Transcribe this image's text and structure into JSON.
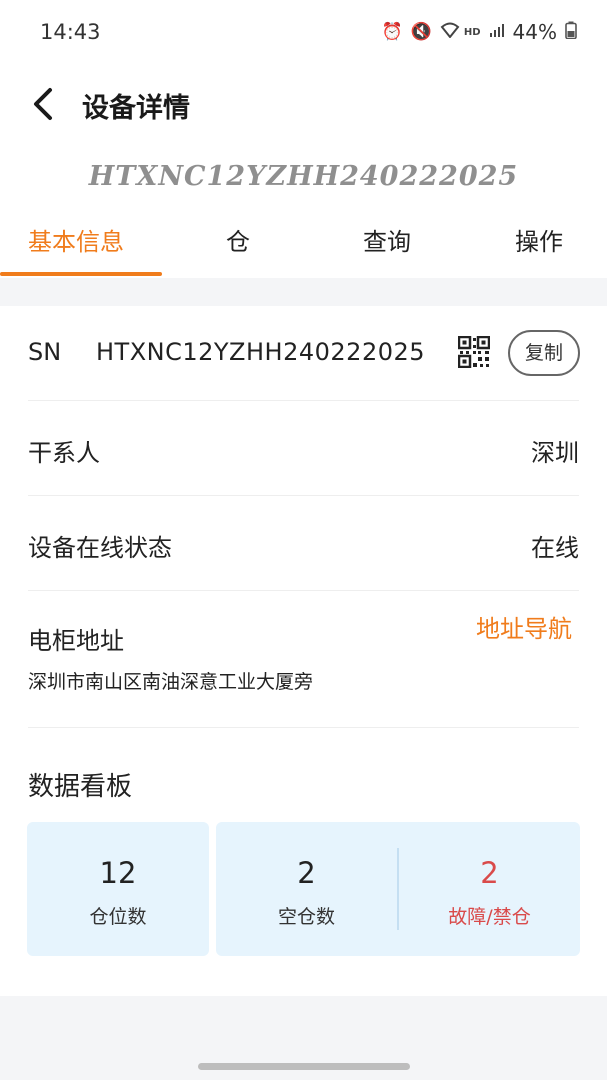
{
  "status_bar": {
    "time": "14:43",
    "network_label": "HD",
    "battery": "44%"
  },
  "header": {
    "title": "设备详情"
  },
  "device_banner": "HTXNC12YZHH240222025",
  "tabs": [
    {
      "label": "基本信息",
      "active": true
    },
    {
      "label": "仓",
      "active": false
    },
    {
      "label": "查询",
      "active": false
    },
    {
      "label": "操作",
      "active": false
    }
  ],
  "info": {
    "sn_label": "SN",
    "sn_value": "HTXNC12YZHH240222025",
    "copy_label": "复制",
    "contact_label": "干系人",
    "contact_value": "深圳",
    "online_label": "设备在线状态",
    "online_value": "在线",
    "address_label": "电柜地址",
    "nav_label": "地址导航",
    "address_value": "深圳市南山区南油深意工业大厦旁"
  },
  "dashboard": {
    "title": "数据看板",
    "stats": [
      {
        "value": "12",
        "label": "仓位数"
      },
      {
        "value": "2",
        "label": "空仓数"
      },
      {
        "value": "2",
        "label": "故障/禁仓"
      }
    ]
  },
  "colors": {
    "accent": "#f07c1c",
    "danger": "#d94a4a",
    "stat_bg": "#e6f4fd"
  }
}
